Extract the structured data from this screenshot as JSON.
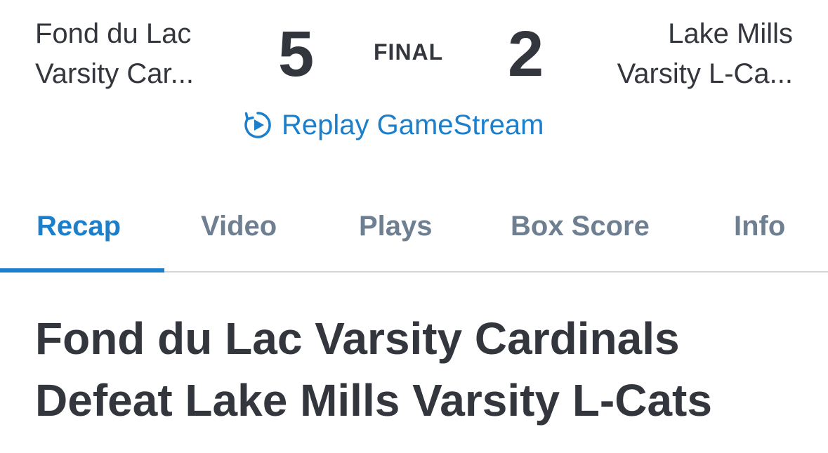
{
  "scoreboard": {
    "home_team": {
      "line1": "Fond du Lac",
      "line2": "Varsity Car..."
    },
    "home_score": "5",
    "status": "FINAL",
    "away_score": "2",
    "away_team": {
      "line1": "Lake Mills",
      "line2": "Varsity L-Ca..."
    },
    "replay": {
      "icon": "replay-icon",
      "label": "Replay GameStream"
    }
  },
  "tabs": [
    {
      "label": "Recap",
      "active": true
    },
    {
      "label": "Video",
      "active": false
    },
    {
      "label": "Plays",
      "active": false
    },
    {
      "label": "Box Score",
      "active": false
    },
    {
      "label": "Info",
      "active": false
    }
  ],
  "recap": {
    "headline": "Fond du Lac Varsity Cardinals Defeat Lake Mills Varsity L-Cats"
  },
  "colors": {
    "accent": "#1b7fcc",
    "text": "#33363d",
    "inactive_tab": "#6f7f92",
    "divider": "#d2d5da"
  }
}
